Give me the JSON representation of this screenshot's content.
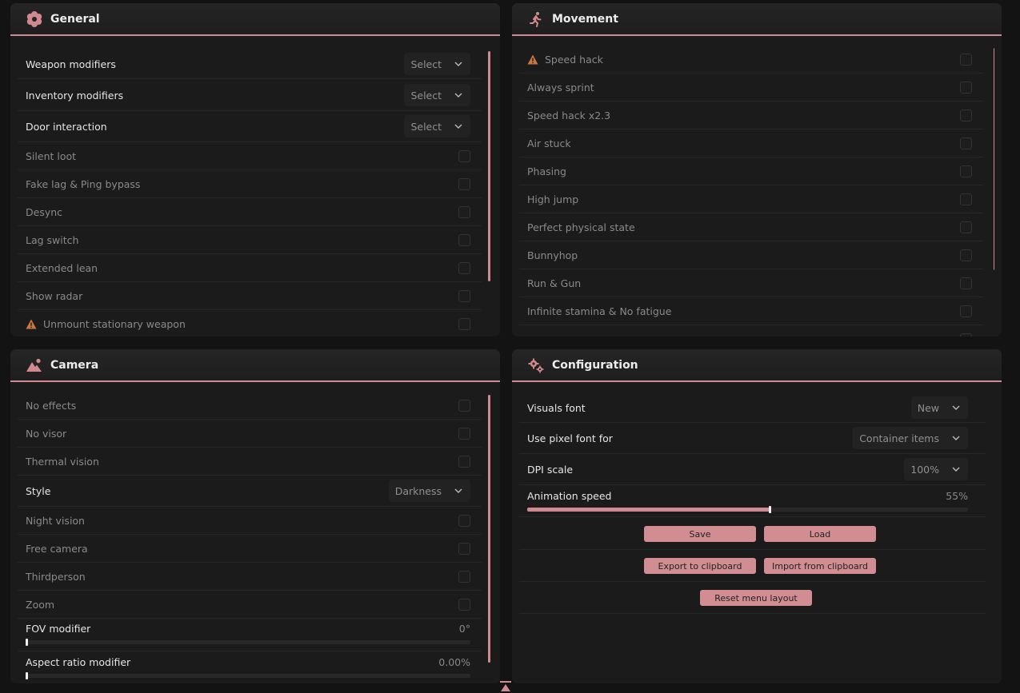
{
  "general": {
    "title": "General",
    "icon": "flower-gear-icon",
    "rows": [
      {
        "label": "Weapon modifiers",
        "type": "select",
        "value": "Select"
      },
      {
        "label": "Inventory modifiers",
        "type": "select",
        "value": "Select"
      },
      {
        "label": "Door interaction",
        "type": "select",
        "value": "Select"
      },
      {
        "label": "Silent loot",
        "type": "checkbox"
      },
      {
        "label": "Fake lag & Ping bypass",
        "type": "checkbox"
      },
      {
        "label": "Desync",
        "type": "checkbox"
      },
      {
        "label": "Lag switch",
        "type": "checkbox"
      },
      {
        "label": "Extended lean",
        "type": "checkbox"
      },
      {
        "label": "Show radar",
        "type": "checkbox"
      },
      {
        "label": "Unmount stationary weapon",
        "type": "checkbox",
        "warning": true
      }
    ]
  },
  "movement": {
    "title": "Movement",
    "icon": "running-person-icon",
    "rows": [
      {
        "label": "Speed hack",
        "warning": true
      },
      {
        "label": "Always sprint"
      },
      {
        "label": "Speed hack x2.3"
      },
      {
        "label": "Air stuck"
      },
      {
        "label": "Phasing"
      },
      {
        "label": "High jump"
      },
      {
        "label": "Perfect physical state"
      },
      {
        "label": "Bunnyhop"
      },
      {
        "label": "Run & Gun"
      },
      {
        "label": "Infinite stamina & No fatigue"
      }
    ]
  },
  "camera": {
    "title": "Camera",
    "icon": "mountain-sun-icon",
    "rows": [
      {
        "label": "No effects",
        "type": "checkbox"
      },
      {
        "label": "No visor",
        "type": "checkbox"
      },
      {
        "label": "Thermal vision",
        "type": "checkbox"
      },
      {
        "label": "Style",
        "type": "select",
        "value": "Darkness"
      },
      {
        "label": "Night vision",
        "type": "checkbox"
      },
      {
        "label": "Free camera",
        "type": "checkbox"
      },
      {
        "label": "Thirdperson",
        "type": "checkbox"
      },
      {
        "label": "Zoom",
        "type": "checkbox"
      }
    ],
    "sliders": [
      {
        "label": "FOV modifier",
        "value": "0°",
        "fraction": 0
      },
      {
        "label": "Aspect ratio modifier",
        "value": "0.00%",
        "fraction": 0
      }
    ]
  },
  "configuration": {
    "title": "Configuration",
    "icon": "gears-icon",
    "rows": [
      {
        "label": "Visuals font",
        "value": "New"
      },
      {
        "label": "Use pixel font for",
        "value": "Container items"
      },
      {
        "label": "DPI scale",
        "value": "100%"
      }
    ],
    "animation_speed": {
      "label": "Animation speed",
      "value": "55%",
      "fraction": 0.55
    },
    "buttons": {
      "save": "Save",
      "load": "Load",
      "export": "Export to clipboard",
      "import": "Import from clipboard",
      "reset": "Reset menu layout"
    }
  },
  "colors": {
    "accent": "#d1898f",
    "panel": "#1b1b1b",
    "background": "#131313",
    "warning": "#c9773e"
  }
}
